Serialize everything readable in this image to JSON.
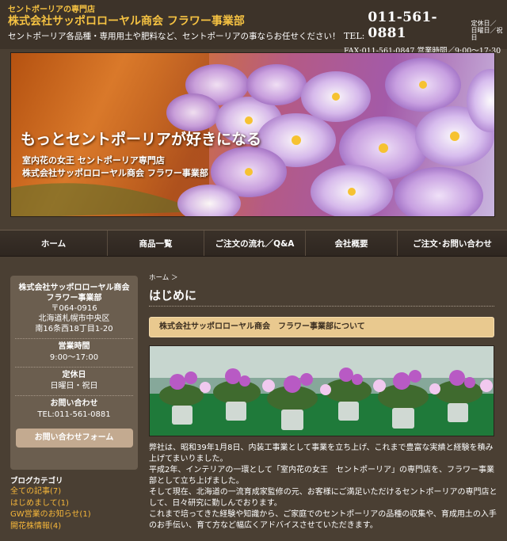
{
  "header": {
    "tagline": "セントポーリアの専門店",
    "company": "株式会社サッポロローヤル商会 フラワー事業部",
    "description": "セントポーリア各品種・専用用土や肥料など、セントポーリアの事ならお任せください！",
    "tel_label": "TEL:",
    "tel_number": "011-561-0881",
    "tel_note_1": "定休日／",
    "tel_note_2": "日曜日／祝日",
    "fax_text": "FAX:011-561-0847 営業時間／9:00～17:30"
  },
  "hero": {
    "headline": "もっとセントポーリアが好きになる",
    "sub1": "室内花の女王 セントポーリア専門店",
    "sub2": "株式会社サッポロローヤル商会 フラワー事業部"
  },
  "nav": {
    "items": [
      {
        "label": "ホーム"
      },
      {
        "label": "商品一覧"
      },
      {
        "label": "ご注文の流れ／Q&A"
      },
      {
        "label": "会社概要"
      },
      {
        "label": "ご注文･お問い合わせ"
      }
    ]
  },
  "sidebar": {
    "company_line1": "株式会社サッポロローヤル商会",
    "company_line2": "フラワー事業部",
    "postal": "〒064-0916",
    "address1": "北海道札幌市中央区",
    "address2": "南16条西18丁目1-20",
    "hours_heading": "営業時間",
    "hours": "9:00～17:00",
    "closed_heading": "定休日",
    "closed": "日曜日・祝日",
    "contact_heading": "お問い合わせ",
    "contact_tel": "TEL:011-561-0881",
    "contact_button": "お問い合わせフォーム"
  },
  "blog": {
    "heading": "ブログカテゴリ",
    "items": [
      {
        "label": "全ての記事(7)"
      },
      {
        "label": "はじめまして(1)"
      },
      {
        "label": "GW営業のお知らせ(1)"
      },
      {
        "label": "開花株情報(4)"
      }
    ]
  },
  "main": {
    "breadcrumb": "ホーム ＞",
    "title": "はじめに",
    "section_heading": "株式会社サッポロローヤル商会　フラワー事業部について",
    "paragraphs": [
      "弊社は、昭和39年1月8日、内装工事業として事業を立ち上げ、これまで豊富な実績と経験を積み上げてまいりました。",
      "平成2年、インテリアの一環として「室内花の女王　セントポーリア」の専門店を、フラワー事業部として立ち上げました。",
      "そして現在、北海道の一流育成家監修の元、お客様にご満足いただけるセントポーリアの専門店として、日々研究に勤しんでおります。",
      "これまで培ってきた経験や知識から、ご家庭でのセントポーリアの品種の収集や、育成用土の入手のお手伝い、育て方など幅広くアドバイスさせていただきます。"
    ]
  },
  "colors": {
    "background": "#4a3f33",
    "accent_gold": "#f5c242",
    "sidebar_bg": "#6b5e4f",
    "button_bg": "#c3aa90",
    "section_bar": "#e9c98f",
    "link": "#f5b63a"
  }
}
